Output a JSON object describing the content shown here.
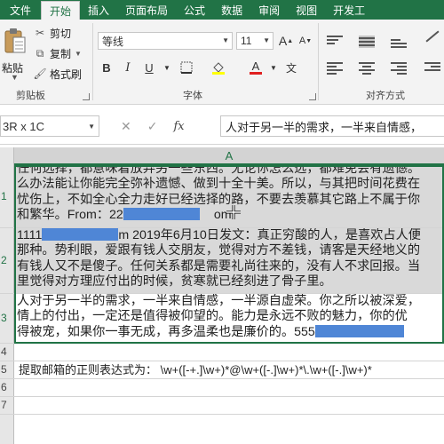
{
  "menubar": {
    "file": "文件",
    "tabs": [
      "开始",
      "插入",
      "页面布局",
      "公式",
      "数据",
      "审阅",
      "视图",
      "开发工"
    ],
    "active_tab": "开始",
    "accent": "#217346"
  },
  "ribbon": {
    "clipboard": {
      "paste": "粘贴",
      "cut": "剪切",
      "copy": "复制",
      "format_painter": "格式刷",
      "group": "剪贴板"
    },
    "font": {
      "font_name": "等线",
      "font_size": "11",
      "group": "字体",
      "bold": "B",
      "italic": "I",
      "underline": "U",
      "font_color_glyph": "A",
      "grow_glyph": "A",
      "shrink_glyph": "A",
      "phonetic_glyph": "文"
    },
    "alignment": {
      "group": "对齐方式"
    }
  },
  "formula_bar": {
    "name_box": "3R x 1C",
    "cancel": "✕",
    "enter": "✓",
    "fx": "fx",
    "formula": "人对于另一半的需求，一半来自情感，"
  },
  "grid": {
    "column": "A",
    "rows": [
      {
        "header": "1",
        "lines": [
          {
            "text": "任何选择，都意味着放弃另一些东西。无论你怎么选，都难免会有遗憾。"
          },
          {
            "text": "么办法能让你能完全弥补遗憾、做到十全十美。所以，与其把时间花费在"
          },
          {
            "text": "忧伤上，不如全心全力走好已经选择的路，不要去羡慕其它路上不属于你"
          },
          {
            "text": "和繁华。From：22",
            "after": "om"
          }
        ]
      },
      {
        "header": "2",
        "lines": [
          {
            "text": "1111",
            "after": "m  2019年6月10日发文：真正穷酸的人，是喜欢占人便"
          },
          {
            "text": "那种。势利眼，爱跟有钱人交朋友，觉得对方不差钱，请客是天经地义的"
          },
          {
            "text": "有钱人又不是傻子。任何关系都是需要礼尚往来的，没有人不求回报。当"
          },
          {
            "text": "里觉得对方理应付出的时候，贫寒就已经刻进了骨子里。"
          }
        ]
      },
      {
        "header": "3",
        "lines": [
          {
            "text": "人对于另一半的需求，一半来自情感，一半源自虚荣。你之所以被深爱，"
          },
          {
            "text": "情上的付出，一定还是值得被仰望的。能力是永远不败的魅力，你的优"
          },
          {
            "text": "得被宠，如果你一事无成，再多温柔也是廉价的。555"
          }
        ]
      },
      {
        "header": "4"
      },
      {
        "header": "5"
      },
      {
        "header": "6",
        "text": "提取邮箱的正则表达式为：  \\w+([-+.]\\w+)*@\\w+([-.]\\w+)*\\.\\w+([-.]\\w+)*"
      },
      {
        "header": "7"
      }
    ]
  }
}
